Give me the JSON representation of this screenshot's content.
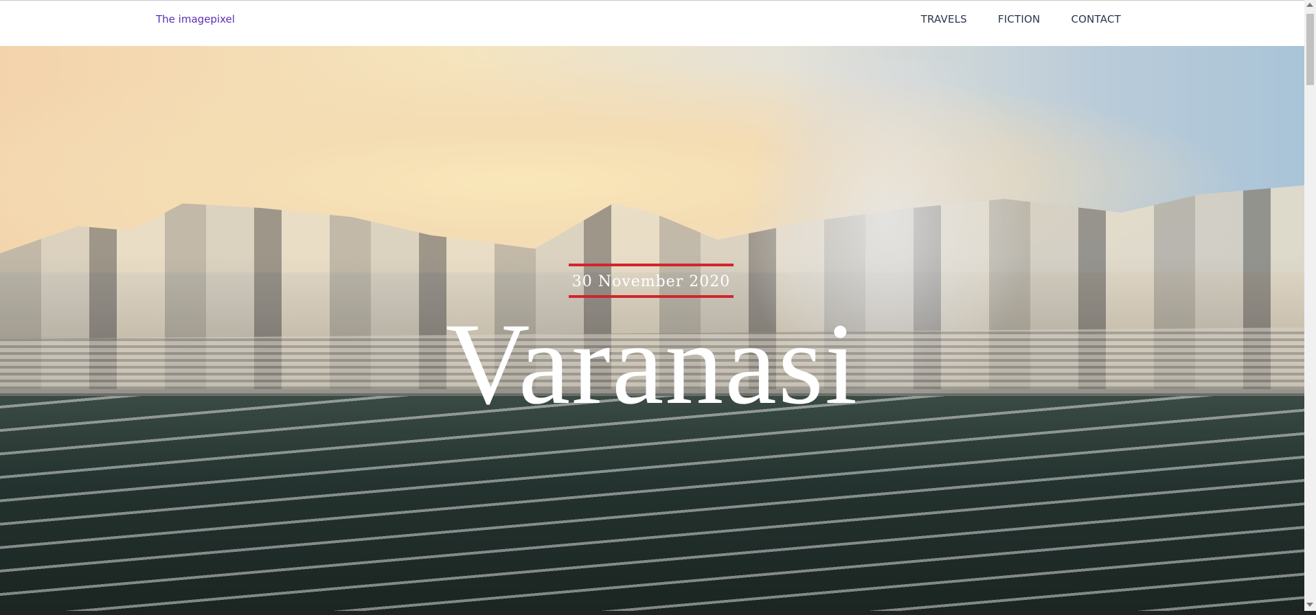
{
  "nav": {
    "brand": "The imagepixel",
    "items": [
      "TRAVELS",
      "FICTION",
      "CONTACT"
    ]
  },
  "hero": {
    "date": "30 November 2020",
    "title": "Varanasi"
  },
  "colors": {
    "brand_text": "#5b2db3",
    "nav_text": "#2a3550",
    "accent_red": "#d3242b"
  }
}
